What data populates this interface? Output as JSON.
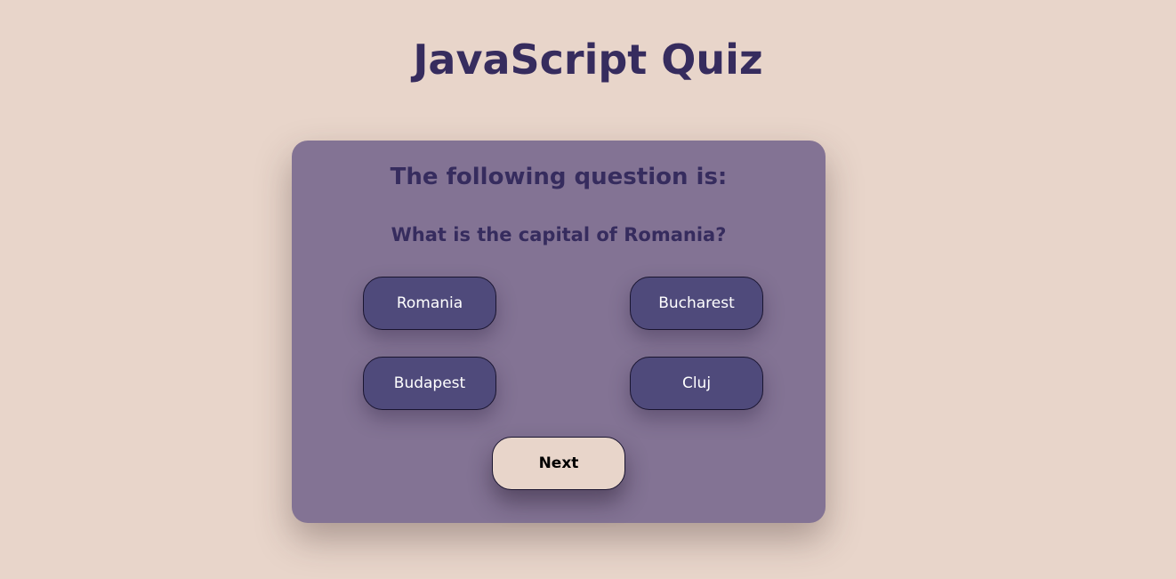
{
  "page": {
    "title": "JavaScript Quiz"
  },
  "quiz": {
    "heading": "The following question is:",
    "question": "What is the capital of Romania?",
    "answers": [
      {
        "label": "Romania"
      },
      {
        "label": "Bucharest"
      },
      {
        "label": "Budapest"
      },
      {
        "label": "Cluj"
      }
    ],
    "next_label": "Next"
  },
  "colors": {
    "background": "#e8d5ca",
    "card": "#837394",
    "heading_text": "#362c5e",
    "answer_button": "#4f4a7b",
    "answer_text": "#ffffff",
    "next_button": "#e8d5ca"
  }
}
